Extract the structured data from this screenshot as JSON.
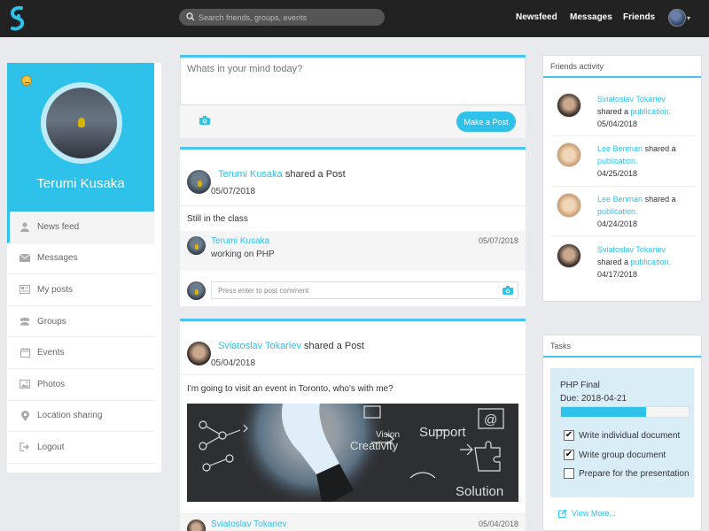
{
  "topbar": {
    "search_placeholder": "Search friends, groups, events",
    "nav": [
      "Newsfeed",
      "Messages",
      "Friends"
    ]
  },
  "profile": {
    "name": "Terumi Kusaka"
  },
  "sidebar": {
    "items": [
      {
        "label": "News feed",
        "icon": "user-icon",
        "active": true
      },
      {
        "label": "Messages",
        "icon": "envelope-icon"
      },
      {
        "label": "My posts",
        "icon": "newspaper-icon"
      },
      {
        "label": "Groups",
        "icon": "users-icon"
      },
      {
        "label": "Events",
        "icon": "calendar-icon"
      },
      {
        "label": "Photos",
        "icon": "image-icon"
      },
      {
        "label": "Location sharing",
        "icon": "map-marker-icon"
      },
      {
        "label": "Logout",
        "icon": "sign-out-icon"
      }
    ]
  },
  "compose": {
    "placeholder": "Whats in your mind today?",
    "button": "Make a Post"
  },
  "posts": [
    {
      "author": "Terumi Kusaka",
      "action": "shared a Post",
      "date": "05/07/2018",
      "text": "Still in the class",
      "comment": {
        "author": "Terumi Kusaka",
        "text": "working on PHP",
        "date": "05/07/2018"
      },
      "comment_placeholder": "Press enter to post comment"
    },
    {
      "author": "Sviatoslav Tokariev",
      "action": "shared a Post",
      "date": "05/04/2018",
      "text": "I'm going to visit an event in Toronto, who's with me?",
      "image_words": [
        "Vision",
        "Creativity",
        "Support",
        "Solution"
      ],
      "comment": {
        "author": "Sviatoslav Tokariev",
        "date": "05/04/2018"
      }
    }
  ],
  "friends_activity": {
    "title": "Friends activity",
    "items": [
      {
        "name": "Sviatoslav Tokariev",
        "action": "shared a",
        "object": "publication.",
        "date": "05/04/2018"
      },
      {
        "name": "Lee Benman",
        "action": "shared a",
        "object": "publication.",
        "date": "04/25/2018"
      },
      {
        "name": "Lee Benman",
        "action": "shared a",
        "object": "publication.",
        "date": "04/24/2018"
      },
      {
        "name": "Sviatoslav Tokariev",
        "action": "shared a",
        "object": "publication.",
        "date": "04/17/2018"
      }
    ]
  },
  "tasks": {
    "title": "Tasks",
    "name": "PHP Final",
    "due": "Due: 2018-04-21",
    "progress": 0.67,
    "items": [
      {
        "label": "Write individual document",
        "checked": true
      },
      {
        "label": "Write group document",
        "checked": true
      },
      {
        "label": "Prepare for the presentation",
        "checked": false
      }
    ],
    "view_more": "View More..."
  },
  "colors": {
    "accent": "#2ec1ea",
    "topbar": "#222222",
    "background": "#e9eaed"
  }
}
